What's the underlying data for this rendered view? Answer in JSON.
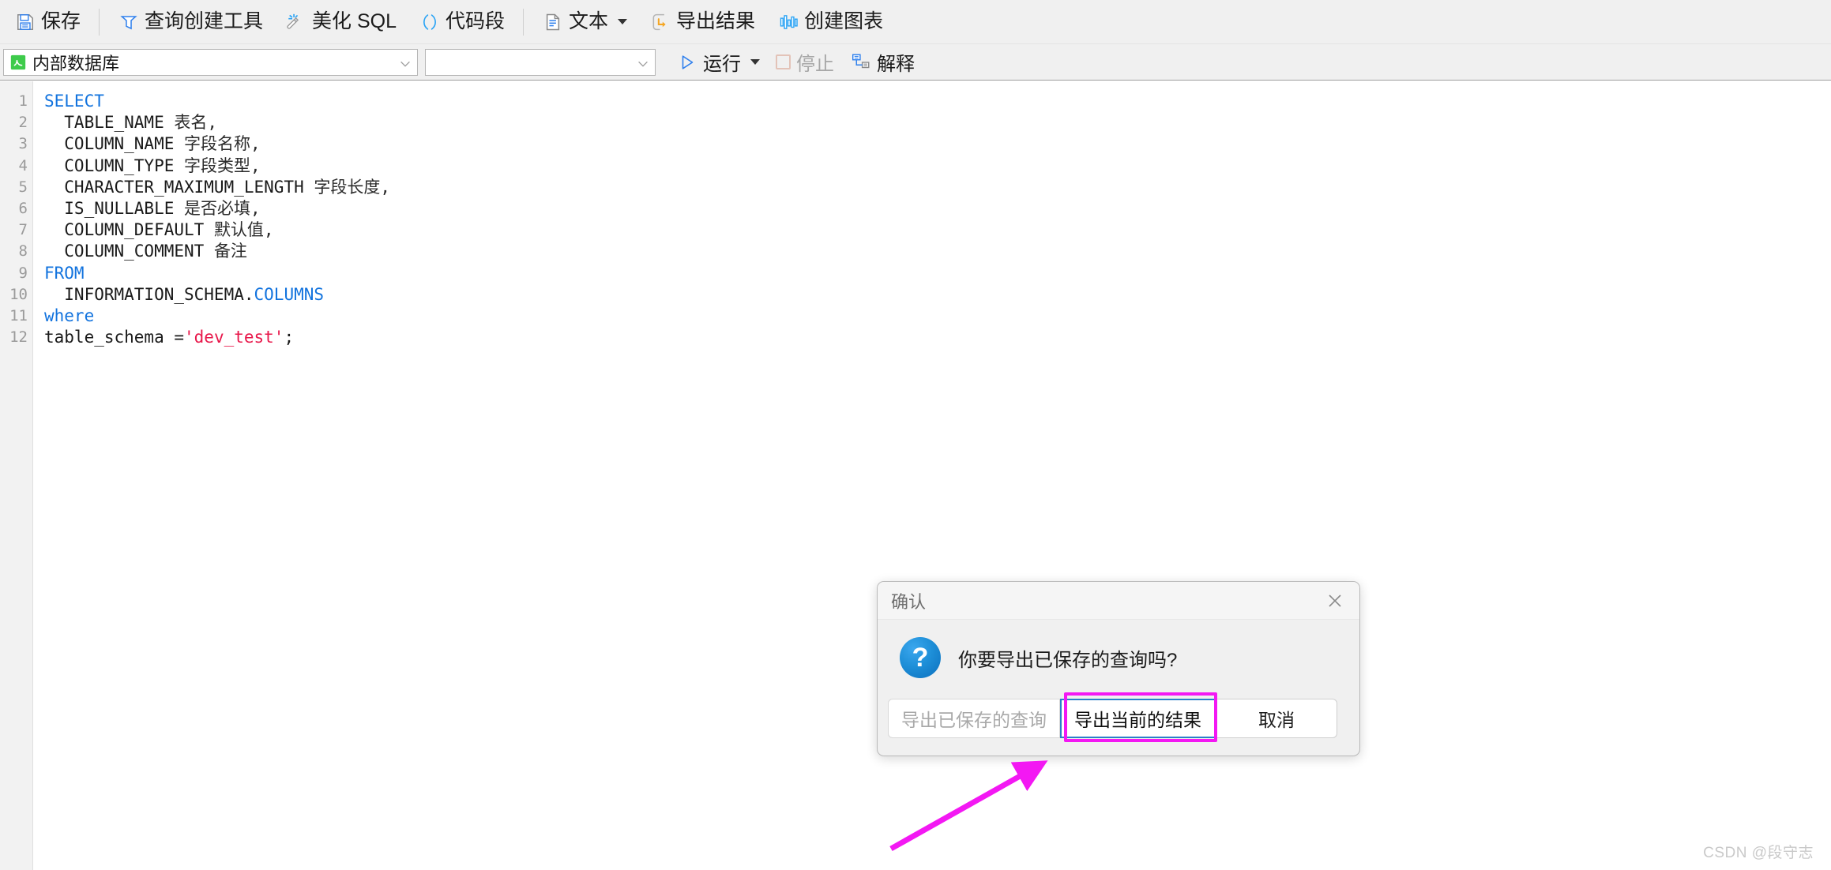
{
  "toolbar": {
    "groups": [
      {
        "items": [
          {
            "id": "save",
            "label": "保存",
            "icon": "save-icon"
          }
        ]
      },
      {
        "items": [
          {
            "id": "query-builder",
            "label": "查询创建工具",
            "icon": "query-builder-icon"
          },
          {
            "id": "beautify-sql",
            "label": "美化 SQL",
            "icon": "magic-wand-icon"
          },
          {
            "id": "snippet",
            "label": "代码段",
            "icon": "parentheses-icon"
          }
        ]
      },
      {
        "items": [
          {
            "id": "text",
            "label": "文本",
            "icon": "document-icon",
            "has_caret": true
          },
          {
            "id": "export-results",
            "label": "导出结果",
            "icon": "export-icon"
          },
          {
            "id": "create-chart",
            "label": "创建图表",
            "icon": "bar-chart-icon"
          }
        ]
      }
    ]
  },
  "subbar": {
    "database_select": {
      "value": "内部数据库",
      "icon": "database-green-icon"
    },
    "schema_select": {
      "value": "",
      "placeholder": ""
    },
    "run_button": {
      "label": "运行",
      "icon": "play-icon",
      "has_caret": true
    },
    "stop_button": {
      "label": "停止",
      "icon": "stop-square-icon",
      "disabled": true
    },
    "explain_button": {
      "label": "解释",
      "icon": "explain-plan-icon"
    }
  },
  "editor": {
    "line_numbers": [
      "1",
      "2",
      "3",
      "4",
      "5",
      "6",
      "7",
      "8",
      "9",
      "10",
      "11",
      "12"
    ],
    "lines": [
      {
        "tokens": [
          {
            "t": "SELECT",
            "c": "kw"
          }
        ]
      },
      {
        "tokens": [
          {
            "t": "  TABLE_NAME ",
            "c": "id"
          },
          {
            "t": "表名,",
            "c": "cn"
          }
        ]
      },
      {
        "tokens": [
          {
            "t": "  COLUMN_NAME ",
            "c": "id"
          },
          {
            "t": "字段名称,",
            "c": "cn"
          }
        ]
      },
      {
        "tokens": [
          {
            "t": "  COLUMN_TYPE ",
            "c": "id"
          },
          {
            "t": "字段类型,",
            "c": "cn"
          }
        ]
      },
      {
        "tokens": [
          {
            "t": "  CHARACTER_MAXIMUM_LENGTH ",
            "c": "id"
          },
          {
            "t": "字段长度,",
            "c": "cn"
          }
        ]
      },
      {
        "tokens": [
          {
            "t": "  IS_NULLABLE ",
            "c": "id"
          },
          {
            "t": "是否必填,",
            "c": "cn"
          }
        ]
      },
      {
        "tokens": [
          {
            "t": "  COLUMN_DEFAULT ",
            "c": "id"
          },
          {
            "t": "默认值,",
            "c": "cn"
          }
        ]
      },
      {
        "tokens": [
          {
            "t": "  COLUMN_COMMENT ",
            "c": "id"
          },
          {
            "t": "备注",
            "c": "cn"
          }
        ]
      },
      {
        "tokens": [
          {
            "t": "FROM",
            "c": "kw"
          }
        ]
      },
      {
        "tokens": [
          {
            "t": "  INFORMATION_SCHEMA.",
            "c": "id"
          },
          {
            "t": "COLUMNS",
            "c": "tbl"
          }
        ]
      },
      {
        "tokens": [
          {
            "t": "where",
            "c": "kw"
          }
        ]
      },
      {
        "tokens": [
          {
            "t": "table_schema =",
            "c": "id"
          },
          {
            "t": "'dev_test'",
            "c": "str"
          },
          {
            "t": ";",
            "c": "id"
          }
        ]
      }
    ],
    "plain_text": "SELECT\n  TABLE_NAME 表名,\n  COLUMN_NAME 字段名称,\n  COLUMN_TYPE 字段类型,\n  CHARACTER_MAXIMUM_LENGTH 字段长度,\n  IS_NULLABLE 是否必填,\n  COLUMN_DEFAULT 默认值,\n  COLUMN_COMMENT 备注\nFROM\n  INFORMATION_SCHEMA.COLUMNS\nwhere\ntable_schema ='dev_test';"
  },
  "dialog": {
    "title": "确认",
    "close_label": "✕",
    "icon": "question-mark-icon",
    "message": "你要导出已保存的查询吗?",
    "buttons": [
      {
        "id": "export-saved-query",
        "label": "导出已保存的查询",
        "state": "disabled"
      },
      {
        "id": "export-current-result",
        "label": "导出当前的结果",
        "state": "focused"
      },
      {
        "id": "cancel",
        "label": "取消",
        "state": "normal"
      }
    ]
  },
  "annotation": {
    "highlight_color": "#f318f3",
    "arrow_color": "#f318f3",
    "target": "导出当前的结果"
  },
  "watermark": {
    "text": "CSDN @段守志"
  }
}
